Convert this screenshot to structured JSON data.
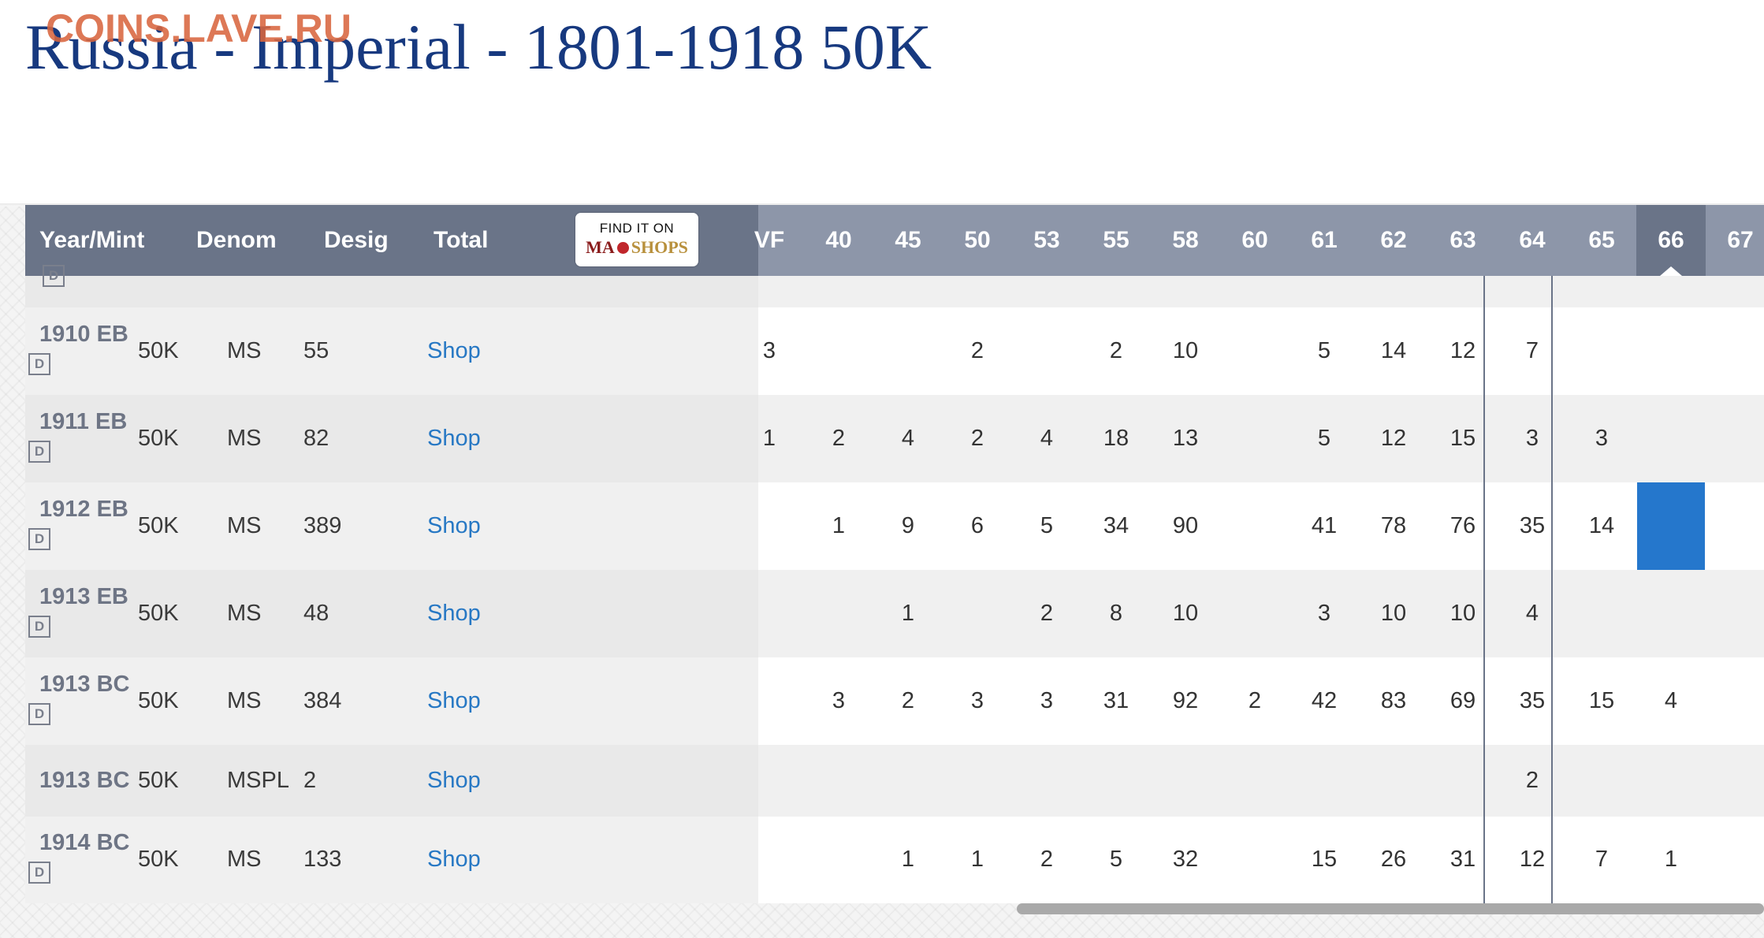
{
  "page": {
    "title": "Russia - Imperial - 1801-1918 50K",
    "watermark": "COINS.LAVE.RU"
  },
  "table": {
    "headers": {
      "year_mint": "Year/Mint",
      "denom": "Denom",
      "desig": "Desig",
      "total": "Total",
      "maps_top": "FIND IT ON",
      "maps_logo_left": "MA",
      "maps_logo_right": "SHOPS",
      "grades": [
        "VF",
        "40",
        "45",
        "50",
        "53",
        "55",
        "58",
        "60",
        "61",
        "62",
        "63",
        "64",
        "65",
        "66",
        "67"
      ],
      "active_grade": "66"
    },
    "partial_row": {
      "badge": "D"
    },
    "rows": [
      {
        "year": "1910 EB",
        "badge": "D",
        "denom": "50K",
        "desig": "MS",
        "total": "55",
        "shop": "Shop",
        "grades": [
          "3",
          "",
          "",
          "2",
          "",
          "2",
          "10",
          "",
          "5",
          "14",
          "12",
          "7",
          "",
          "",
          ""
        ]
      },
      {
        "year": "1911 EB",
        "badge": "D",
        "denom": "50K",
        "desig": "MS",
        "total": "82",
        "shop": "Shop",
        "grades": [
          "1",
          "2",
          "4",
          "2",
          "4",
          "18",
          "13",
          "",
          "5",
          "12",
          "15",
          "3",
          "3",
          "",
          ""
        ]
      },
      {
        "year": "1912 EB",
        "badge": "D",
        "denom": "50K",
        "desig": "MS",
        "total": "389",
        "shop": "Shop",
        "grades": [
          "",
          "1",
          "9",
          "6",
          "5",
          "34",
          "90",
          "",
          "41",
          "78",
          "76",
          "35",
          "14",
          "",
          ""
        ]
      },
      {
        "year": "1913 EB",
        "badge": "D",
        "denom": "50K",
        "desig": "MS",
        "total": "48",
        "shop": "Shop",
        "grades": [
          "",
          "",
          "1",
          "",
          "2",
          "8",
          "10",
          "",
          "3",
          "10",
          "10",
          "4",
          "",
          "",
          ""
        ]
      },
      {
        "year": "1913 BC",
        "badge": "D",
        "denom": "50K",
        "desig": "MS",
        "total": "384",
        "shop": "Shop",
        "grades": [
          "",
          "3",
          "2",
          "3",
          "3",
          "31",
          "92",
          "2",
          "42",
          "83",
          "69",
          "35",
          "15",
          "4",
          ""
        ]
      },
      {
        "year": "1913 BC",
        "badge": "",
        "denom": "50K",
        "desig": "MSPL",
        "total": "2",
        "shop": "Shop",
        "grades": [
          "",
          "",
          "",
          "",
          "",
          "",
          "",
          "",
          "",
          "",
          "",
          "2",
          "",
          "",
          ""
        ]
      },
      {
        "year": "1914 BC",
        "badge": "D",
        "denom": "50K",
        "desig": "MS",
        "total": "133",
        "shop": "Shop",
        "grades": [
          "",
          "",
          "1",
          "1",
          "2",
          "5",
          "32",
          "",
          "15",
          "26",
          "31",
          "12",
          "7",
          "1",
          ""
        ]
      }
    ],
    "highlighted_cell": {
      "row": "1912 EB",
      "grade": "66",
      "color": "#2577cc"
    }
  },
  "colors": {
    "title": "#17397f",
    "watermark": "#d9663f",
    "header_dark": "#6a7488",
    "header_light": "#8d96a9",
    "shop_link": "#2778c4",
    "highlight": "#2577cc"
  }
}
